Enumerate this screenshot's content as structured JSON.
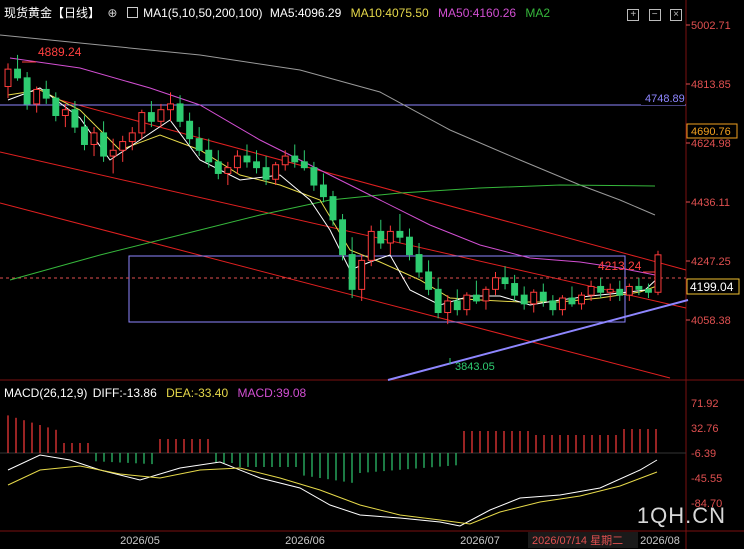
{
  "header": {
    "title": "现货黄金【日线】",
    "ma_params": "MA1(5,10,50,200,100)",
    "ma5": "MA5:4096.29",
    "ma10": "MA10:4075.50",
    "ma50": "MA50:4160.26",
    "ma2": "MA2"
  },
  "macd_header": {
    "params": "MACD(26,12,9)",
    "diff": "DIFF:-13.86",
    "dea": "DEA:-33.40",
    "macd": "MACD:39.08"
  },
  "price_axis": [
    "5002.71",
    "4813.85",
    "4624.98",
    "4436.11",
    "4247.25",
    "4058.38"
  ],
  "price_tags": {
    "hline": "4748.89",
    "ma_tag": "4690.76",
    "last": "4199.04"
  },
  "annotations": {
    "high": "4889.24",
    "low": "3843.05",
    "recent_high": "4213.24"
  },
  "macd_axis": [
    "71.92",
    "32.76",
    "-6.39",
    "-45.55",
    "-84.70"
  ],
  "date_axis": [
    "2026/05",
    "2026/06",
    "2026/07",
    "2026/08"
  ],
  "cursor_date": "2026/07/14 星期二",
  "watermark": "1QH.CN",
  "colors": {
    "up": "#ff3b3b",
    "down": "#2ecc71",
    "ma5": "#ffffff",
    "ma10": "#e6d94a",
    "ma50": "#d24fd2",
    "ma100": "#9a9a9a",
    "ma200": "#36b83c",
    "diff": "#ffffff",
    "dea": "#e6d94a",
    "macd_label": "#d24fd2",
    "channel": "#e02020",
    "trend": "#8e86ff",
    "box": "#8e86ff"
  },
  "chart_data": {
    "type": "candlestick",
    "title": "现货黄金【日线】",
    "y_range": [
      3843.05,
      5002.71
    ],
    "horizontal_line": 4748.89,
    "last_price": 4199.04,
    "high_label": 4889.24,
    "low_label": 3843.05,
    "moving_averages": {
      "MA5": 4096.29,
      "MA10": 4075.5,
      "MA50": 4160.26
    },
    "macd": {
      "params": "26,12,9",
      "DIFF": -13.86,
      "DEA": -33.4,
      "MACD": 39.08
    },
    "x_labels": [
      "2026/05",
      "2026/06",
      "2026/07",
      "2026/08"
    ],
    "ohlc": [
      [
        4780,
        4860,
        4740,
        4840
      ],
      [
        4840,
        4889.24,
        4800,
        4810
      ],
      [
        4810,
        4830,
        4700,
        4720
      ],
      [
        4720,
        4780,
        4690,
        4770
      ],
      [
        4770,
        4800,
        4720,
        4740
      ],
      [
        4740,
        4760,
        4660,
        4680
      ],
      [
        4680,
        4720,
        4640,
        4700
      ],
      [
        4700,
        4730,
        4620,
        4640
      ],
      [
        4640,
        4680,
        4560,
        4580
      ],
      [
        4580,
        4640,
        4540,
        4620
      ],
      [
        4620,
        4660,
        4520,
        4540
      ],
      [
        4540,
        4600,
        4480,
        4560
      ],
      [
        4560,
        4610,
        4520,
        4590
      ],
      [
        4590,
        4640,
        4560,
        4620
      ],
      [
        4620,
        4700,
        4600,
        4690
      ],
      [
        4690,
        4730,
        4640,
        4660
      ],
      [
        4660,
        4720,
        4640,
        4700
      ],
      [
        4700,
        4760,
        4660,
        4720
      ],
      [
        4720,
        4750,
        4640,
        4660
      ],
      [
        4660,
        4690,
        4580,
        4600
      ],
      [
        4600,
        4640,
        4540,
        4560
      ],
      [
        4560,
        4600,
        4500,
        4520
      ],
      [
        4520,
        4560,
        4460,
        4480
      ],
      [
        4480,
        4520,
        4440,
        4500
      ],
      [
        4500,
        4560,
        4480,
        4540
      ],
      [
        4540,
        4580,
        4500,
        4520
      ],
      [
        4520,
        4560,
        4480,
        4500
      ],
      [
        4500,
        4540,
        4440,
        4460
      ],
      [
        4460,
        4520,
        4440,
        4510
      ],
      [
        4510,
        4560,
        4490,
        4540
      ],
      [
        4540,
        4580,
        4500,
        4520
      ],
      [
        4520,
        4560,
        4490,
        4500
      ],
      [
        4500,
        4520,
        4420,
        4440
      ],
      [
        4440,
        4480,
        4380,
        4400
      ],
      [
        4400,
        4420,
        4300,
        4320
      ],
      [
        4320,
        4340,
        4180,
        4200
      ],
      [
        4200,
        4260,
        4050,
        4080
      ],
      [
        4080,
        4200,
        4040,
        4180
      ],
      [
        4180,
        4300,
        4160,
        4280
      ],
      [
        4280,
        4320,
        4220,
        4240
      ],
      [
        4240,
        4300,
        4200,
        4280
      ],
      [
        4280,
        4340,
        4240,
        4260
      ],
      [
        4260,
        4290,
        4180,
        4200
      ],
      [
        4200,
        4240,
        4120,
        4140
      ],
      [
        4140,
        4180,
        4060,
        4080
      ],
      [
        4080,
        4120,
        3980,
        4000
      ],
      [
        4000,
        4060,
        3960,
        4040
      ],
      [
        4040,
        4080,
        3990,
        4010
      ],
      [
        4010,
        4070,
        3990,
        4060
      ],
      [
        4060,
        4110,
        4030,
        4040
      ],
      [
        4040,
        4090,
        4010,
        4080
      ],
      [
        4080,
        4140,
        4060,
        4120
      ],
      [
        4120,
        4160,
        4080,
        4100
      ],
      [
        4100,
        4130,
        4040,
        4060
      ],
      [
        4060,
        4090,
        4010,
        4030
      ],
      [
        4030,
        4080,
        4000,
        4070
      ],
      [
        4070,
        4100,
        4020,
        4040
      ],
      [
        4040,
        4060,
        3990,
        4010
      ],
      [
        4010,
        4060,
        3990,
        4050
      ],
      [
        4050,
        4090,
        4020,
        4030
      ],
      [
        4030,
        4070,
        4010,
        4060
      ],
      [
        4060,
        4110,
        4040,
        4090
      ],
      [
        4090,
        4120,
        4050,
        4070
      ],
      [
        4070,
        4100,
        4040,
        4080
      ],
      [
        4080,
        4110,
        4040,
        4060
      ],
      [
        4060,
        4100,
        4040,
        4090
      ],
      [
        4090,
        4120,
        4060,
        4080
      ],
      [
        4080,
        4100,
        4050,
        4070
      ],
      [
        4070,
        4213.24,
        4060,
        4199.04
      ]
    ]
  }
}
